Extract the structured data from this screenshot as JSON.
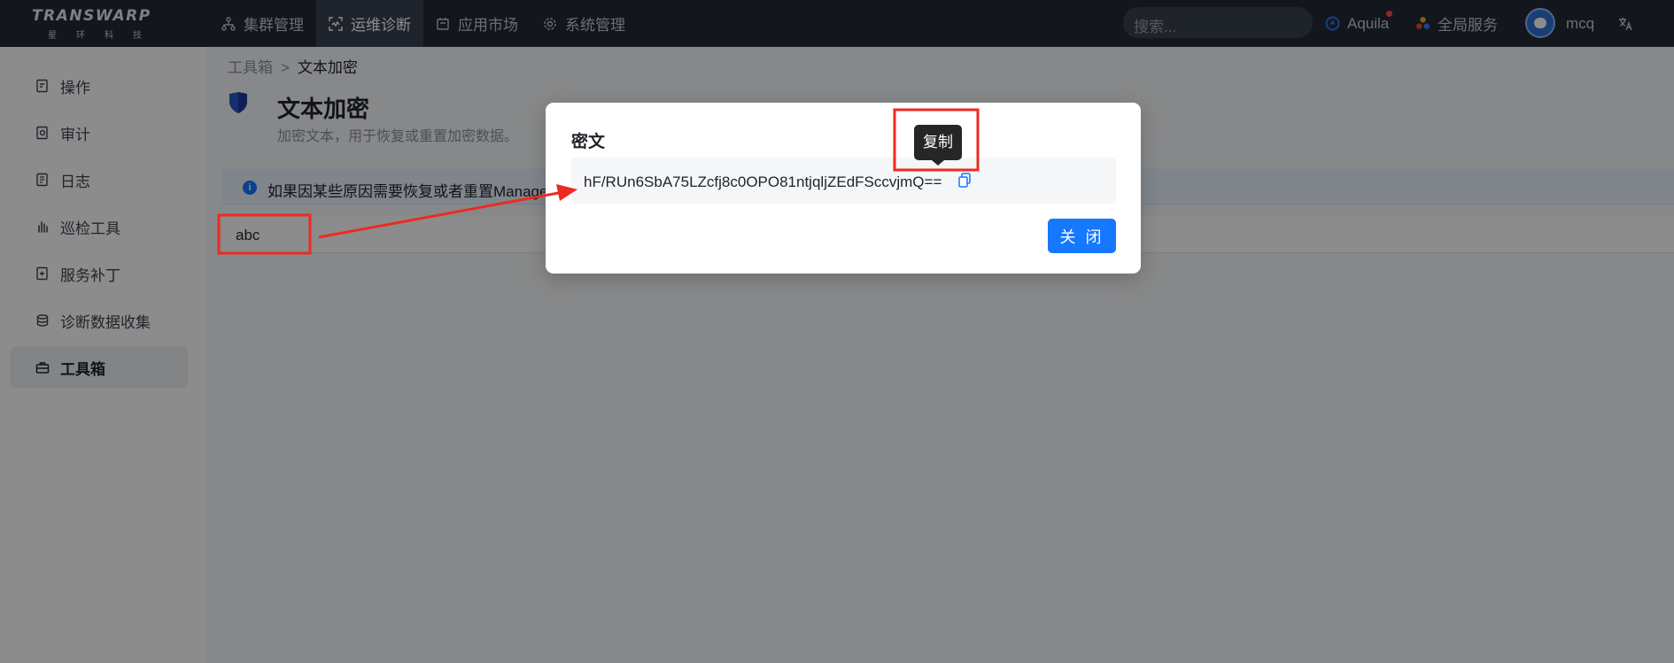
{
  "topbar": {
    "logo": {
      "name": "TRANSWARP",
      "sub": "星环科技"
    },
    "nav": [
      {
        "label": "集群管理",
        "icon": "cluster-icon",
        "active": false
      },
      {
        "label": "运维诊断",
        "icon": "diagnosis-icon",
        "active": true
      },
      {
        "label": "应用市场",
        "icon": "market-icon",
        "active": false
      },
      {
        "label": "系统管理",
        "icon": "gear-icon",
        "active": false
      }
    ],
    "search_placeholder": "搜索...",
    "aquila": "Aquila",
    "global_services": "全局服务",
    "user": "mcq",
    "language_icon": "translate-icon"
  },
  "sidebar": {
    "items": [
      {
        "label": "操作",
        "icon": "operation-icon"
      },
      {
        "label": "审计",
        "icon": "audit-icon"
      },
      {
        "label": "日志",
        "icon": "log-icon"
      },
      {
        "label": "巡检工具",
        "icon": "inspect-icon"
      },
      {
        "label": "服务补丁",
        "icon": "patch-icon"
      },
      {
        "label": "诊断数据收集",
        "icon": "collect-icon"
      },
      {
        "label": "工具箱",
        "icon": "toolbox-icon",
        "active": true
      }
    ]
  },
  "main": {
    "breadcrumb": {
      "parent": "工具箱",
      "separator": ">",
      "current": "文本加密"
    },
    "title": "文本加密",
    "description": "加密文本，用于恢复或重置加密数据。",
    "alert_text": "如果因某些原因需要恢复或者重置Manager",
    "input_value": "abc"
  },
  "modal": {
    "title": "密文",
    "cipher_text": "hF/RUn6SbA75LZcfj8c0OPO81ntjqljZEdFSccvjmQ==",
    "close_label": "关 闭",
    "tooltip": "复制"
  },
  "colors": {
    "primary": "#1677ff",
    "topbar_bg": "#232a36",
    "annotation": "#ee2a1f"
  }
}
